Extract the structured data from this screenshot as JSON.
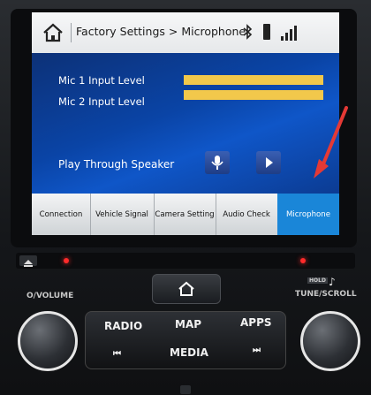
{
  "screen": {
    "breadcrumb": "Factory Settings > Microphone",
    "rows": [
      {
        "label": "Mic 1 Input Level",
        "level": 1.0
      },
      {
        "label": "Mic 2 Input Level",
        "level": 1.0
      }
    ],
    "play_label": "Play Through Speaker",
    "tabs": [
      {
        "label": "Connection",
        "active": false
      },
      {
        "label": "Vehicle Signal",
        "active": false
      },
      {
        "label": "Camera Setting",
        "active": false
      },
      {
        "label": "Audio Check",
        "active": false
      },
      {
        "label": "Microphone",
        "active": true
      }
    ],
    "colors": {
      "bar": "#f2c84b",
      "active_tab": "#1a86d8",
      "annotation": "#e53935"
    },
    "icons": {
      "header": [
        "home-icon",
        "bluetooth-icon",
        "battery-icon",
        "signal-icon"
      ],
      "buttons": [
        "microphone-icon",
        "play-icon"
      ]
    }
  },
  "hardware": {
    "volume_label": "O/VOLUME",
    "tune_label": "TUNE/SCROLL",
    "hold_label": "HOLD",
    "buttons": {
      "radio": "RADIO",
      "map": "MAP",
      "apps": "APPS",
      "media": "MEDIA",
      "prev": "⏮",
      "next": "⏭"
    },
    "icons": [
      "eject-icon",
      "home-icon",
      "music-note-icon"
    ]
  }
}
